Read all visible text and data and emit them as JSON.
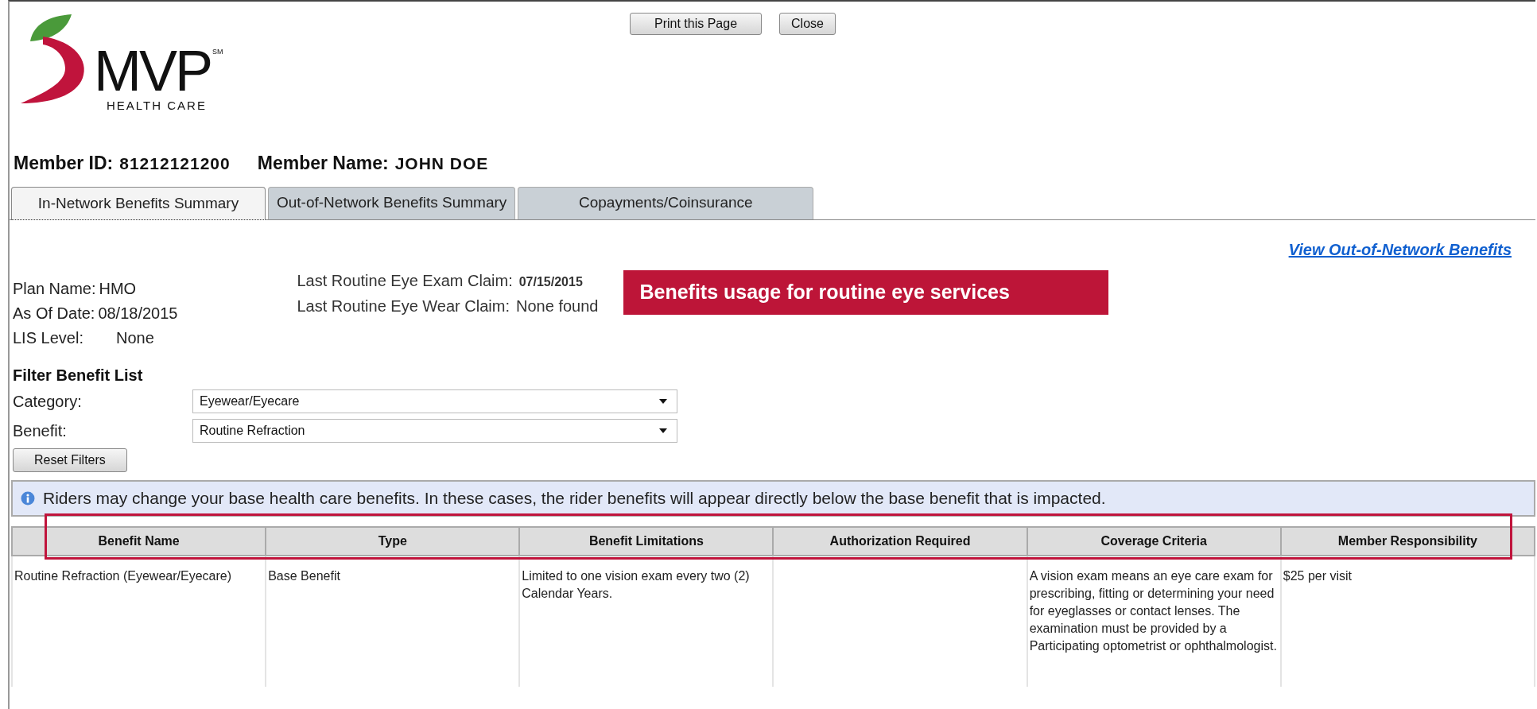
{
  "logo": {
    "wordmark": "MVP",
    "trademark": "SM",
    "tagline": "HEALTH CARE"
  },
  "header_buttons": [
    "Print this Page",
    "Close"
  ],
  "member": {
    "id_label": "Member ID:",
    "id": "81212121200",
    "name_label": "Member Name:",
    "name": "JOHN DOE"
  },
  "tabs": [
    {
      "label": "In-Network Benefits Summary",
      "selected": true
    },
    {
      "label": "Out-of-Network Benefits Summary",
      "selected": false
    },
    {
      "label": "Copayments/Coinsurance",
      "selected": false
    }
  ],
  "link": "View Out-of-Network Benefits",
  "plan_info": [
    {
      "label": "Plan Name:",
      "value": "HMO"
    },
    {
      "label": "As Of Date:",
      "value": "08/18/2015"
    },
    {
      "label": "LIS Level:",
      "value": "None"
    }
  ],
  "claims": [
    {
      "label": "Last Routine Eye Exam Claim:",
      "value": "07/15/2015",
      "bold": true
    },
    {
      "label": "Last Routine Eye Wear Claim:",
      "value": "None found",
      "bold": false
    }
  ],
  "callout": "Benefits usage for routine eye services",
  "filter": {
    "title": "Filter Benefit List",
    "fields": [
      {
        "label": "Category:",
        "value": "Eyewear/Eyecare"
      },
      {
        "label": "Benefit:",
        "value": "Routine Refraction"
      }
    ],
    "reset_button": "Reset Filters"
  },
  "notice": "Riders may change your base health care benefits. In these cases, the rider benefits will appear directly below the base benefit that is impacted.",
  "table": {
    "columns": [
      "Benefit Name",
      "Type",
      "Benefit Limitations",
      "Authorization Required",
      "Coverage Criteria",
      "Member Responsibility"
    ],
    "rows": [
      [
        "Routine Refraction (Eyewear/Eyecare)",
        "Base Benefit",
        "Limited to one vision exam every two (2) Calendar Years.",
        "",
        "A vision exam means an eye care exam for prescribing, fitting or determining your need for eyeglasses or contact lenses. The examination must be provided by a Participating optometrist or ophthalmologist.",
        "$25 per visit"
      ]
    ]
  }
}
